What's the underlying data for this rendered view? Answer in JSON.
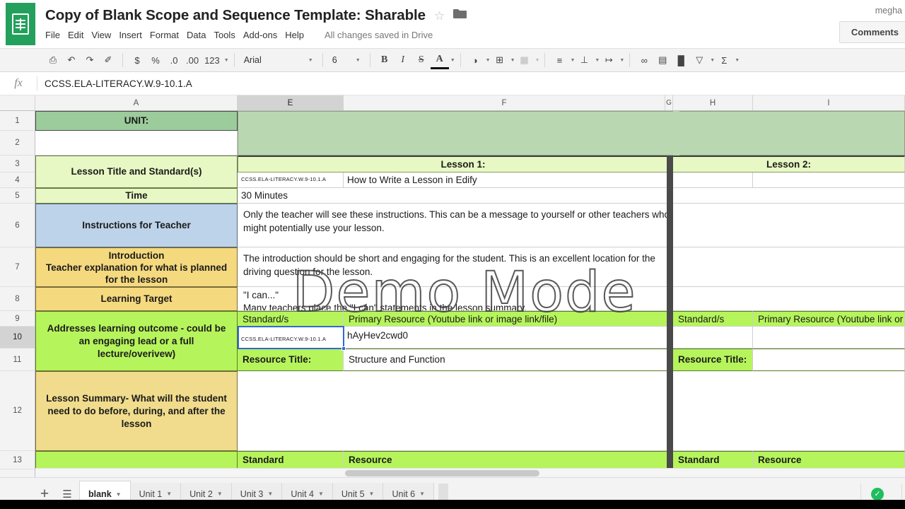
{
  "header": {
    "doc_title": "Copy of Blank Scope and Sequence Template: Sharable",
    "star_icon": "star-outline-icon",
    "folder_icon": "folder-icon",
    "menus": [
      "File",
      "Edit",
      "View",
      "Insert",
      "Format",
      "Data",
      "Tools",
      "Add-ons",
      "Help"
    ],
    "save_state": "All changes saved in Drive",
    "account_name": "megha",
    "comments_label": "Comments"
  },
  "toolbar": {
    "items": [
      {
        "name": "print-icon",
        "glyph": "⎙"
      },
      {
        "name": "undo-icon",
        "glyph": "↶"
      },
      {
        "name": "redo-icon",
        "glyph": "↷"
      },
      {
        "name": "paint-format-icon",
        "glyph": "✐"
      },
      {
        "name": "currency-format-icon",
        "glyph": "$"
      },
      {
        "name": "percent-format-icon",
        "glyph": "%"
      },
      {
        "name": "decrease-decimal-icon",
        "glyph": ".0"
      },
      {
        "name": "increase-decimal-icon",
        "glyph": ".00"
      },
      {
        "name": "more-formats-icon",
        "glyph": "123"
      },
      {
        "name": "fill-color-icon",
        "glyph": "◑"
      },
      {
        "name": "borders-icon",
        "glyph": "⊞"
      },
      {
        "name": "merge-cells-icon",
        "glyph": "▦"
      },
      {
        "name": "horizontal-align-icon",
        "glyph": "≡"
      },
      {
        "name": "vertical-align-icon",
        "glyph": "⊥"
      },
      {
        "name": "text-wrap-icon",
        "glyph": "↦"
      },
      {
        "name": "insert-link-icon",
        "glyph": "∞"
      },
      {
        "name": "insert-comment-icon",
        "glyph": "▤"
      },
      {
        "name": "insert-chart-icon",
        "glyph": "█"
      },
      {
        "name": "filter-icon",
        "glyph": "▽"
      },
      {
        "name": "functions-icon",
        "glyph": "Σ"
      }
    ],
    "font_name": "Arial",
    "font_size": "6",
    "bold": "B",
    "italic": "I",
    "strikethrough": "S",
    "text_color": "A"
  },
  "formula_bar": {
    "fx_label": "fx",
    "value": "CCSS.ELA-LITERACY.W.9-10.1.A"
  },
  "grid": {
    "columns": [
      "A",
      "E",
      "F",
      "G",
      "H",
      "I"
    ],
    "selected_column": "E",
    "rows": [
      "1",
      "2",
      "3",
      "4",
      "5",
      "6",
      "7",
      "8",
      "9",
      "10",
      "11",
      "12",
      "13"
    ],
    "active_row": "10",
    "selected_cell_value": "CCSS.ELA-LITERACY.W.9-10.1.A",
    "col_a": {
      "r1": "UNIT:",
      "r2": "",
      "r3_4": "Lesson Title and Standard(s)",
      "r5": "Time",
      "r6": "Instructions for Teacher",
      "r7": "Introduction\nTeacher explanation for what is planned for the lesson",
      "r7_line1": "Introduction",
      "r7_line2": "Teacher explanation for what is planned",
      "r7_line3": "for the lesson",
      "r8": "Learning Target",
      "r9_11_line1": "Addresses learning outcome - could be",
      "r9_11_line2": "an engaging lead or a full",
      "r9_11_line3": "lecture/overivew)",
      "r12_line1": "Lesson Summary- What will the student",
      "r12_line2": "need to do before, during, and after the",
      "r12_line3": "lesson",
      "r13": ""
    },
    "lesson1": {
      "title": "Lesson 1:",
      "standard_mini": "CCSS.ELA-LITERACY.W.9-10.1.A",
      "lesson_name": "How to Write a Lesson in Edify",
      "time": "30 Minutes",
      "instructions": "Only the teacher will see these instructions. This can be a message to yourself or other teachers who might potentially use your lesson.",
      "introduction": "The introduction should be short and engaging for the student. This is an excellent location for the driving question for the lesson.",
      "learning_target_line1": "\"I can...\"",
      "learning_target_line2": "Many teachers place the \"I can\" statements in the lesson summary.",
      "standards_header": "Standard/s",
      "primary_resource_header": "Primary Resource (Youtube link or image link/file)",
      "standard_cell_mini": "CCSS.ELA-LITERACY.W.9-10.1.A",
      "resource_value": "hAyHev2cwd0",
      "resource_title_label": "Resource Title:",
      "resource_title_value": "Structure and Function",
      "summary": "",
      "standard_footer": "Standard",
      "resource_footer": "Resource"
    },
    "lesson2": {
      "title": "Lesson 2:",
      "standards_header": "Standard/s",
      "primary_resource_header": "Primary Resource (Youtube link or image link/file)",
      "resource_title_label": "Resource Title:",
      "standard_footer": "Standard",
      "resource_footer": "Resource"
    }
  },
  "watermark": {
    "text": "Demo Mode"
  },
  "tabs": {
    "add_label": "+",
    "all_sheets_icon": "all-sheets-icon",
    "sheets": [
      "blank",
      "Unit 1",
      "Unit 2",
      "Unit 3",
      "Unit 4",
      "Unit 5",
      "Unit 6"
    ],
    "active_sheet": "blank",
    "status_icon": "saved-check-icon",
    "status_glyph": "✓"
  },
  "colors": {
    "brand_green": "#23a05b",
    "unit_green": "#9ccc9b",
    "pale_green": "#e3f4c6",
    "bright_green": "#b6f45c",
    "blue": "#bdd3e9",
    "yellow": "#f5d97e",
    "selection_blue": "#3367d6"
  }
}
